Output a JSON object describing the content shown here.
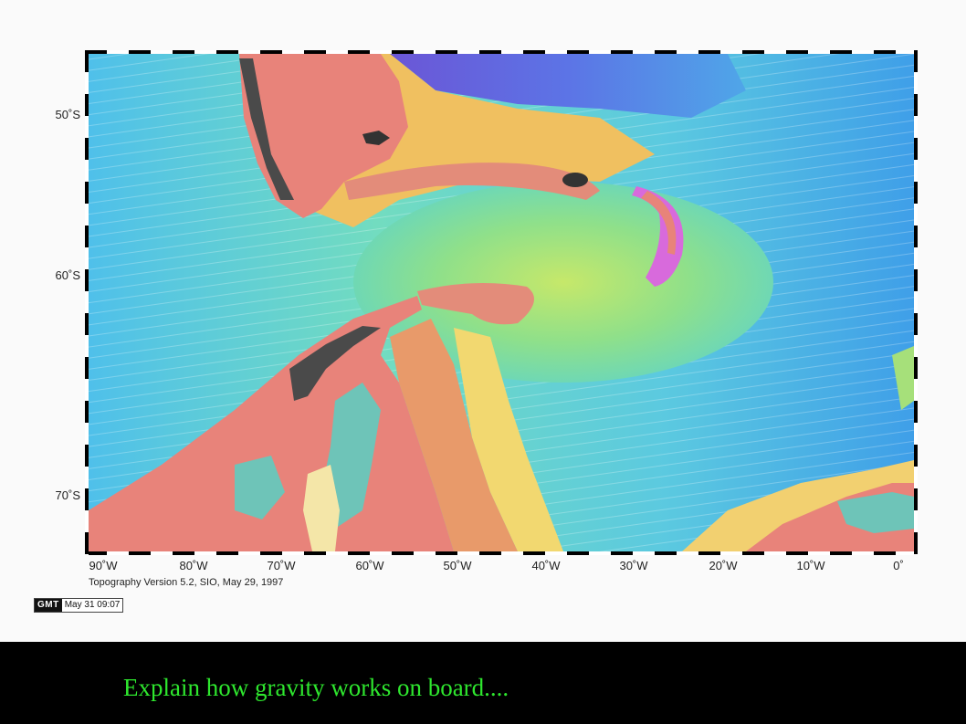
{
  "map": {
    "type": "topography-map",
    "region": "Scotia Sea / Drake Passage, South Atlantic",
    "colors": {
      "land": "#e8837a",
      "shallow": "#cde65a",
      "mid_depth": "#6fdc9a",
      "deep": "#4fb8e6",
      "deepest": "#6a6ae0",
      "mountains": "#4a4a4a"
    },
    "lat_labels": [
      "50˚S",
      "60˚S",
      "70˚S"
    ],
    "lon_labels": [
      "90˚W",
      "80˚W",
      "70˚W",
      "60˚W",
      "50˚W",
      "40˚W",
      "30˚W",
      "20˚W",
      "10˚W",
      "0˚"
    ]
  },
  "caption": "Topography Version 5.2, SIO, May 29, 1997",
  "gmt_stamp": {
    "logo": "GMT",
    "date": "May 31 09:07"
  },
  "slide_text": "Explain how gravity works on board...."
}
